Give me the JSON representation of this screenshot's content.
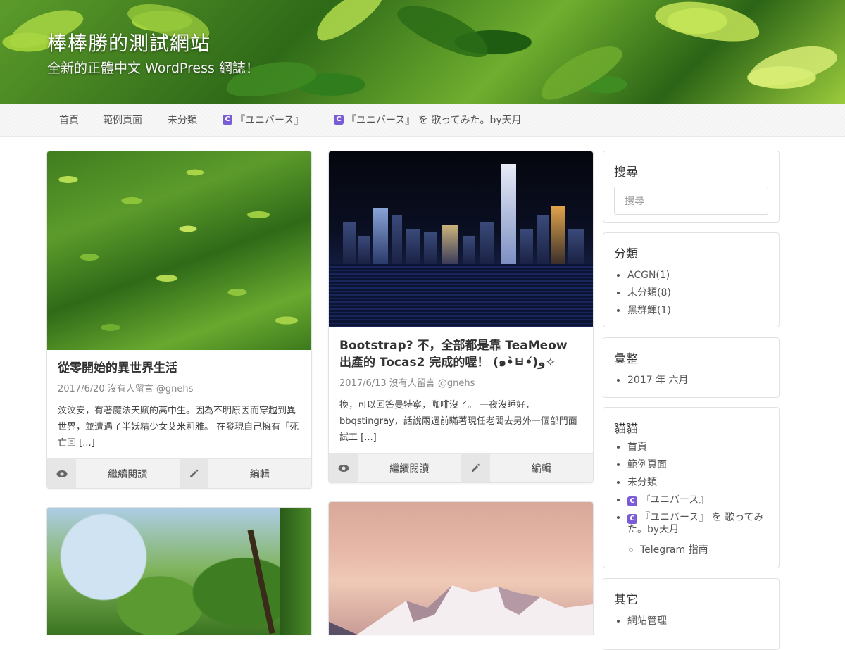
{
  "site": {
    "title": "棒棒勝的測試網站",
    "tagline": "全新的正體中文 WordPress 網誌！"
  },
  "nav": {
    "items": [
      "首頁",
      "範例頁面",
      "未分類",
      "『ユニバース』",
      "『ユニバース』 を 歌ってみた。by天月"
    ],
    "icon_glyph": "C"
  },
  "posts": [
    {
      "title": "從零開始的異世界生活",
      "meta": "2017/6/20  沒有人留言  @gnehs",
      "excerpt": "汶汶安，有著魔法天賦的高中生。因為不明原因而穿越到異世界，並遭遇了半妖精少女艾米莉雅。 在發現自己擁有「死亡回 [...]",
      "read_label": "繼續閱讀",
      "edit_label": "編輯"
    },
    {
      "title": "Bootstrap? 不，全部都是靠 TeaMeow 出產的 Tocas2 完成的喔！ (๑•̀ㅂ•́)و✧",
      "meta": "2017/6/13  沒有人留言  @gnehs",
      "excerpt": "換，可以回答曼特寧，咖啡沒了。 一夜沒睡好，bbqstingray，話說兩週前瞞著現任老闆去另外一個部門面試工 [...]",
      "read_label": "繼續閱讀",
      "edit_label": "編輯"
    }
  ],
  "sidebar": {
    "search": {
      "title": "搜尋",
      "placeholder": "搜尋"
    },
    "categories": {
      "title": "分類",
      "items": [
        "ACGN(1)",
        "未分類(8)",
        "黑群輝(1)"
      ]
    },
    "archives": {
      "title": "彙整",
      "items": [
        "2017 年 六月"
      ]
    },
    "pages": {
      "title": "貓貓",
      "items": [
        "首頁",
        "範例頁面",
        "未分類",
        "『ユニバース』",
        "『ユニバース』 を 歌ってみた。by天月"
      ],
      "sub_item": "Telegram 指南"
    },
    "meta": {
      "title": "其它",
      "items": [
        "網站管理"
      ]
    }
  },
  "colors": {
    "accent_icon": "#7a5cd6",
    "header_green": "#5c9b2b"
  }
}
